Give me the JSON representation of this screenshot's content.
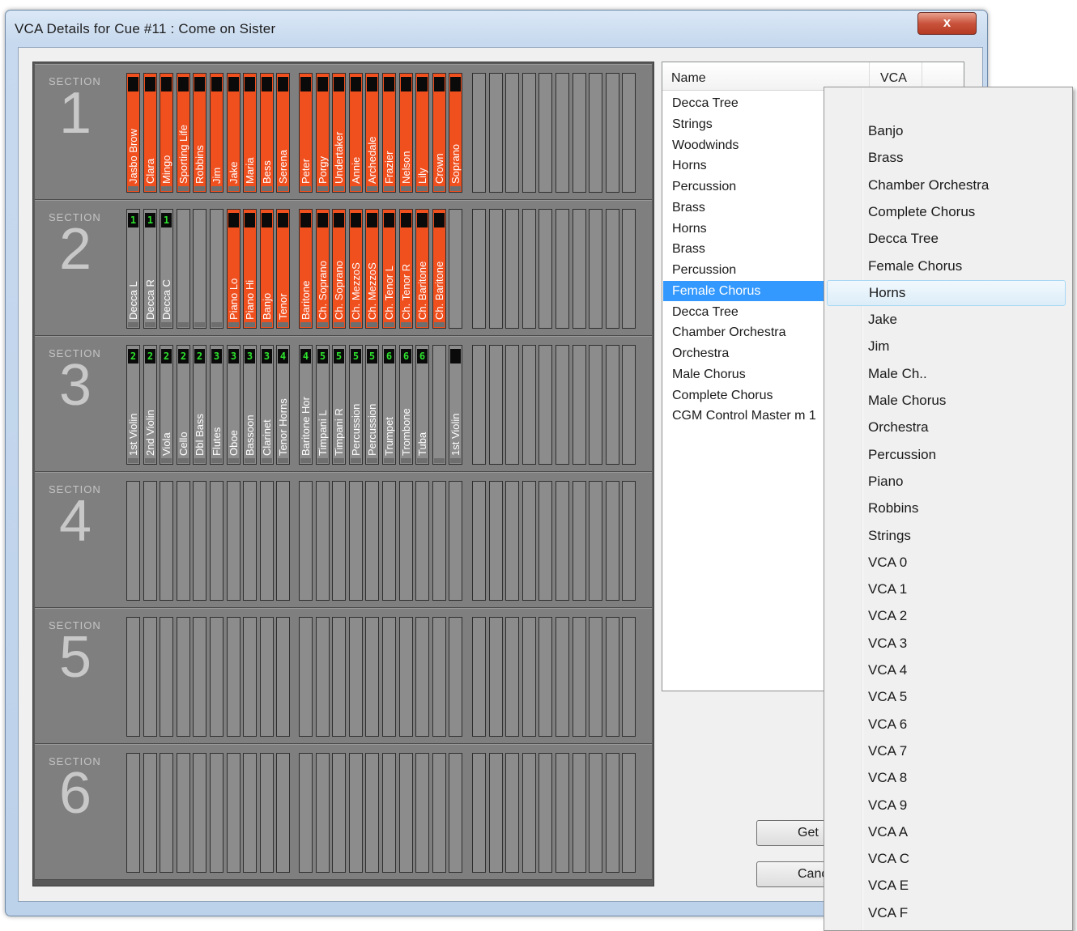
{
  "window": {
    "title": "VCA Details for Cue #11 : Come on Sister",
    "close_label": "x"
  },
  "mixer": {
    "section_label": "SECTION",
    "sections": [
      {
        "number": "1",
        "strips": [
          {
            "label": "Jasbo Brow",
            "active": true,
            "top": "",
            "top_style": "black"
          },
          {
            "label": "Clara",
            "active": true,
            "top": "",
            "top_style": "black"
          },
          {
            "label": "Mingo",
            "active": true,
            "top": "",
            "top_style": "black"
          },
          {
            "label": "Sporting Life",
            "active": true,
            "top": "",
            "top_style": "black"
          },
          {
            "label": "Robbins",
            "active": true,
            "top": "",
            "top_style": "black"
          },
          {
            "label": "Jim",
            "active": true,
            "top": "",
            "top_style": "black"
          },
          {
            "label": "Jake",
            "active": true,
            "top": "",
            "top_style": "black"
          },
          {
            "label": "Maria",
            "active": true,
            "top": "",
            "top_style": "black"
          },
          {
            "label": "Bess",
            "active": true,
            "top": "",
            "top_style": "black"
          },
          {
            "label": "Serena",
            "active": true,
            "top": "",
            "top_style": "black"
          },
          {
            "label": "Peter",
            "active": true,
            "top": "",
            "top_style": "black"
          },
          {
            "label": "Porgy",
            "active": true,
            "top": "",
            "top_style": "black"
          },
          {
            "label": "Undertaker",
            "active": true,
            "top": "",
            "top_style": "black"
          },
          {
            "label": "Annie",
            "active": true,
            "top": "",
            "top_style": "black"
          },
          {
            "label": "Archedale",
            "active": true,
            "top": "",
            "top_style": "black"
          },
          {
            "label": "Frazier",
            "active": true,
            "top": "",
            "top_style": "black"
          },
          {
            "label": "Nelson",
            "active": true,
            "top": "",
            "top_style": "black"
          },
          {
            "label": "Lily",
            "active": true,
            "top": "",
            "top_style": "black"
          },
          {
            "label": "Crown",
            "active": true,
            "top": "",
            "top_style": "black"
          },
          {
            "label": "Soprano",
            "active": true,
            "top": "",
            "top_style": "black"
          }
        ]
      },
      {
        "number": "2",
        "strips": [
          {
            "label": "Decca L",
            "active": false,
            "top": "1",
            "top_style": "green"
          },
          {
            "label": "Decca R",
            "active": false,
            "top": "1",
            "top_style": "green"
          },
          {
            "label": "Decca C",
            "active": false,
            "top": "1",
            "top_style": "green"
          },
          {
            "label": "",
            "active": false,
            "top": "",
            "top_style": "none"
          },
          {
            "label": "",
            "active": false,
            "top": "",
            "top_style": "none"
          },
          {
            "label": "",
            "active": false,
            "top": "",
            "top_style": "none"
          },
          {
            "label": "Piano Lo",
            "active": true,
            "top": "",
            "top_style": "black"
          },
          {
            "label": "Piano Hi",
            "active": true,
            "top": "",
            "top_style": "black"
          },
          {
            "label": "Banjo",
            "active": true,
            "top": "",
            "top_style": "black"
          },
          {
            "label": "Tenor",
            "active": true,
            "top": "",
            "top_style": "black"
          },
          {
            "label": "Baritone",
            "active": true,
            "top": "",
            "top_style": "black"
          },
          {
            "label": "Ch. Soprano",
            "active": true,
            "top": "",
            "top_style": "black"
          },
          {
            "label": "Ch. Soprano",
            "active": true,
            "top": "",
            "top_style": "black"
          },
          {
            "label": "Ch. MezzoS",
            "active": true,
            "top": "",
            "top_style": "black"
          },
          {
            "label": "Ch. MezzoS",
            "active": true,
            "top": "",
            "top_style": "black"
          },
          {
            "label": "Ch. Tenor L",
            "active": true,
            "top": "",
            "top_style": "black"
          },
          {
            "label": "Ch. Tenor R",
            "active": true,
            "top": "",
            "top_style": "black"
          },
          {
            "label": "Ch. Baritone",
            "active": true,
            "top": "",
            "top_style": "black"
          },
          {
            "label": "Ch. Baritone",
            "active": true,
            "top": "",
            "top_style": "black"
          }
        ]
      },
      {
        "number": "3",
        "strips": [
          {
            "label": "1st Violin",
            "active": false,
            "top": "2",
            "top_style": "green"
          },
          {
            "label": "2nd Violin",
            "active": false,
            "top": "2",
            "top_style": "green"
          },
          {
            "label": "Viola",
            "active": false,
            "top": "2",
            "top_style": "green"
          },
          {
            "label": "Cello",
            "active": false,
            "top": "2",
            "top_style": "green"
          },
          {
            "label": "Dbl Bass",
            "active": false,
            "top": "2",
            "top_style": "green"
          },
          {
            "label": "Flutes",
            "active": false,
            "top": "3",
            "top_style": "green"
          },
          {
            "label": "Oboe",
            "active": false,
            "top": "3",
            "top_style": "green"
          },
          {
            "label": "Bassoon",
            "active": false,
            "top": "3",
            "top_style": "green"
          },
          {
            "label": "Clarinet",
            "active": false,
            "top": "3",
            "top_style": "green"
          },
          {
            "label": "Tenor Horns",
            "active": false,
            "top": "4",
            "top_style": "green"
          },
          {
            "label": "Baritone Hor",
            "active": false,
            "top": "4",
            "top_style": "green"
          },
          {
            "label": "Timpani L",
            "active": false,
            "top": "5",
            "top_style": "green"
          },
          {
            "label": "Timpani R",
            "active": false,
            "top": "5",
            "top_style": "green"
          },
          {
            "label": "Percussion",
            "active": false,
            "top": "5",
            "top_style": "green"
          },
          {
            "label": "Percussion",
            "active": false,
            "top": "5",
            "top_style": "green"
          },
          {
            "label": "Trumpet",
            "active": false,
            "top": "6",
            "top_style": "green"
          },
          {
            "label": "Trombone",
            "active": false,
            "top": "6",
            "top_style": "green"
          },
          {
            "label": "Tuba",
            "active": false,
            "top": "6",
            "top_style": "green"
          },
          {
            "label": "",
            "active": false,
            "top": "",
            "top_style": "none"
          },
          {
            "label": "1st Violin",
            "active": false,
            "top": "",
            "top_style": "black"
          }
        ]
      },
      {
        "number": "4",
        "strips": []
      },
      {
        "number": "5",
        "strips": []
      },
      {
        "number": "6",
        "strips": []
      }
    ]
  },
  "listview": {
    "columns": [
      "Name",
      "VCA"
    ],
    "rows": [
      "Decca Tree",
      "Strings",
      "Woodwinds",
      "Horns",
      "Percussion",
      "Brass",
      "Horns",
      "Brass",
      "Percussion",
      "Female Chorus",
      "Decca Tree",
      "Chamber Orchestra",
      "Orchestra",
      "Male Chorus",
      "Complete Chorus",
      "CGM  Control Master m 1"
    ],
    "selected_index": 9
  },
  "buttons": {
    "get_label": "Get",
    "cancel_label": "Cance"
  },
  "dropdown": {
    "items": [
      "Banjo",
      "Brass",
      "Chamber Orchestra",
      "Complete Chorus",
      "Decca Tree",
      "Female Chorus",
      "Horns",
      "Jake",
      "Jim",
      "Male Ch..",
      "Male Chorus",
      "Orchestra",
      "Percussion",
      "Piano",
      "Robbins",
      "Strings",
      "VCA 0",
      "VCA 1",
      "VCA 2",
      "VCA 3",
      "VCA 4",
      "VCA 5",
      "VCA 6",
      "VCA 7",
      "VCA 8",
      "VCA 9",
      "VCA A",
      "VCA C",
      "VCA E",
      "VCA F"
    ],
    "hover_index": 6
  }
}
